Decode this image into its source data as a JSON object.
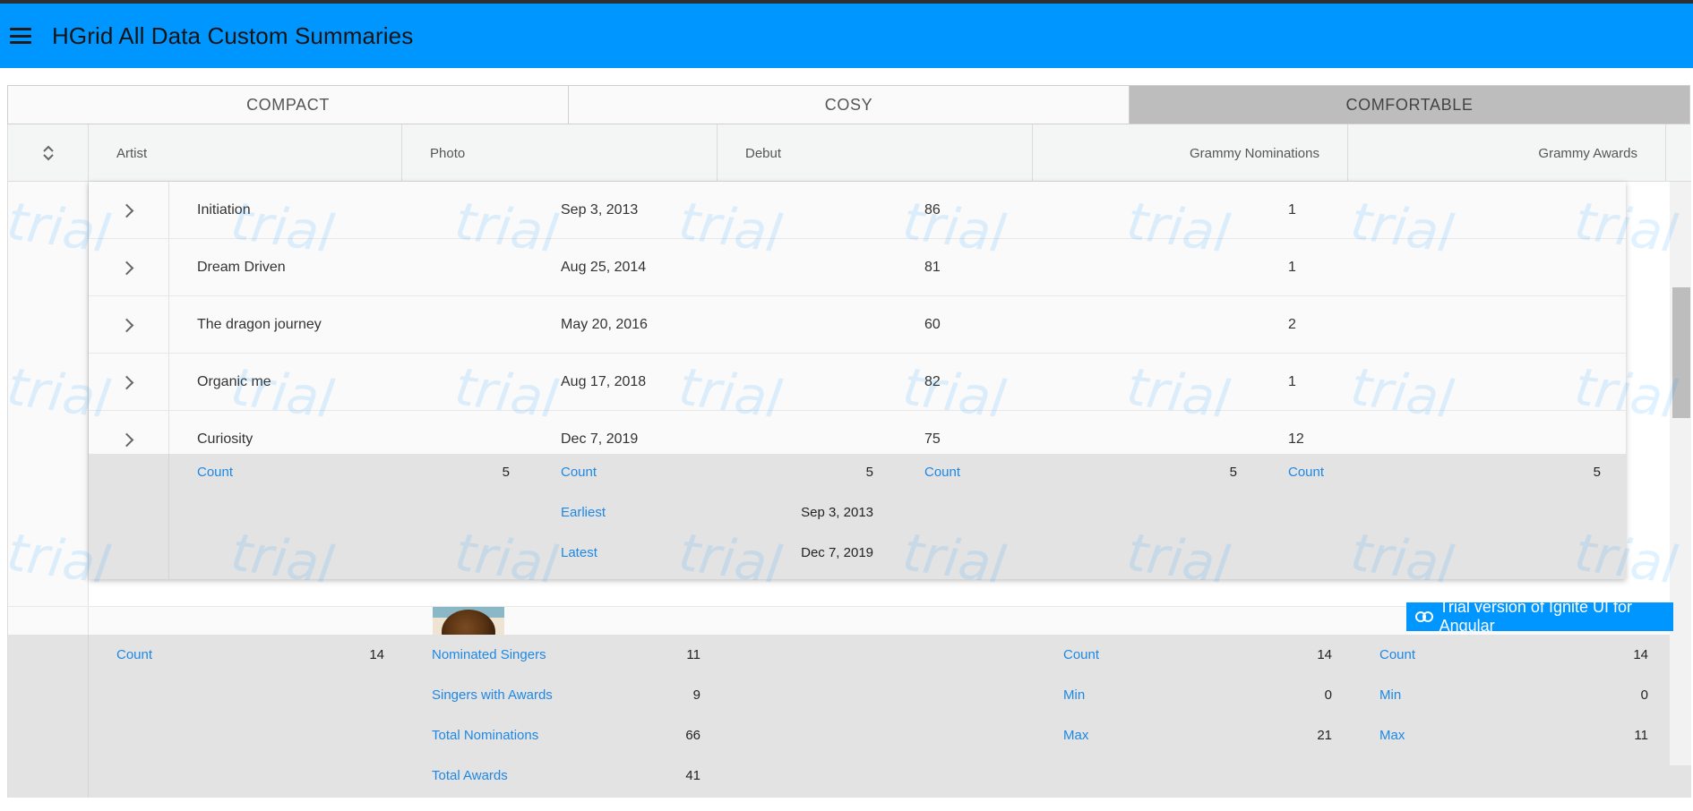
{
  "app": {
    "title": "HGrid All Data Custom Summaries"
  },
  "density": {
    "options": [
      "COMPACT",
      "COSY",
      "COMFORTABLE"
    ],
    "selected": "COMFORTABLE"
  },
  "grid": {
    "columns": [
      "Artist",
      "Photo",
      "Debut",
      "Grammy Nominations",
      "Grammy Awards"
    ],
    "child_rows": [
      {
        "album": "Initiation",
        "launch": "Sep 3, 2013",
        "score": "86",
        "toptrack": "1"
      },
      {
        "album": "Dream Driven",
        "launch": "Aug 25, 2014",
        "score": "81",
        "toptrack": "1"
      },
      {
        "album": "The dragon journey",
        "launch": "May 20, 2016",
        "score": "60",
        "toptrack": "2"
      },
      {
        "album": "Organic me",
        "launch": "Aug 17, 2018",
        "score": "82",
        "toptrack": "1"
      },
      {
        "album": "Curiosity",
        "launch": "Dec 7, 2019",
        "score": "75",
        "toptrack": "12"
      }
    ],
    "child_summary": {
      "col1": [
        {
          "label": "Count",
          "value": "5"
        }
      ],
      "col2": [
        {
          "label": "Count",
          "value": "5"
        },
        {
          "label": "Earliest",
          "value": "Sep 3, 2013"
        },
        {
          "label": "Latest",
          "value": "Dec 7, 2019"
        }
      ],
      "col3": [
        {
          "label": "Count",
          "value": "5"
        }
      ],
      "col4": [
        {
          "label": "Count",
          "value": "5"
        }
      ]
    },
    "parent_summary": {
      "artist": [
        {
          "label": "Count",
          "value": "14"
        }
      ],
      "photo": [
        {
          "label": "Nominated Singers",
          "value": "11"
        },
        {
          "label": "Singers with Awards",
          "value": "9"
        },
        {
          "label": "Total Nominations",
          "value": "66"
        },
        {
          "label": "Total Awards",
          "value": "41"
        }
      ],
      "nominations": [
        {
          "label": "Count",
          "value": "14"
        },
        {
          "label": "Min",
          "value": "0"
        },
        {
          "label": "Max",
          "value": "21"
        }
      ],
      "awards": [
        {
          "label": "Count",
          "value": "14"
        },
        {
          "label": "Min",
          "value": "0"
        },
        {
          "label": "Max",
          "value": "11"
        }
      ]
    }
  },
  "trial": {
    "banner": "Trial version of Ignite UI for Angular",
    "watermark": "trial"
  },
  "icons": {
    "menu": "menu-icon",
    "collapse_all": "collapse-all-icon",
    "expand_row": "chevron-right-icon",
    "link": "link-icon"
  },
  "colors": {
    "appbar": "#0096ff",
    "summary_label": "#1e88e5",
    "summary_bg": "#e3e3e3",
    "density_active": "#bdbdbd"
  }
}
